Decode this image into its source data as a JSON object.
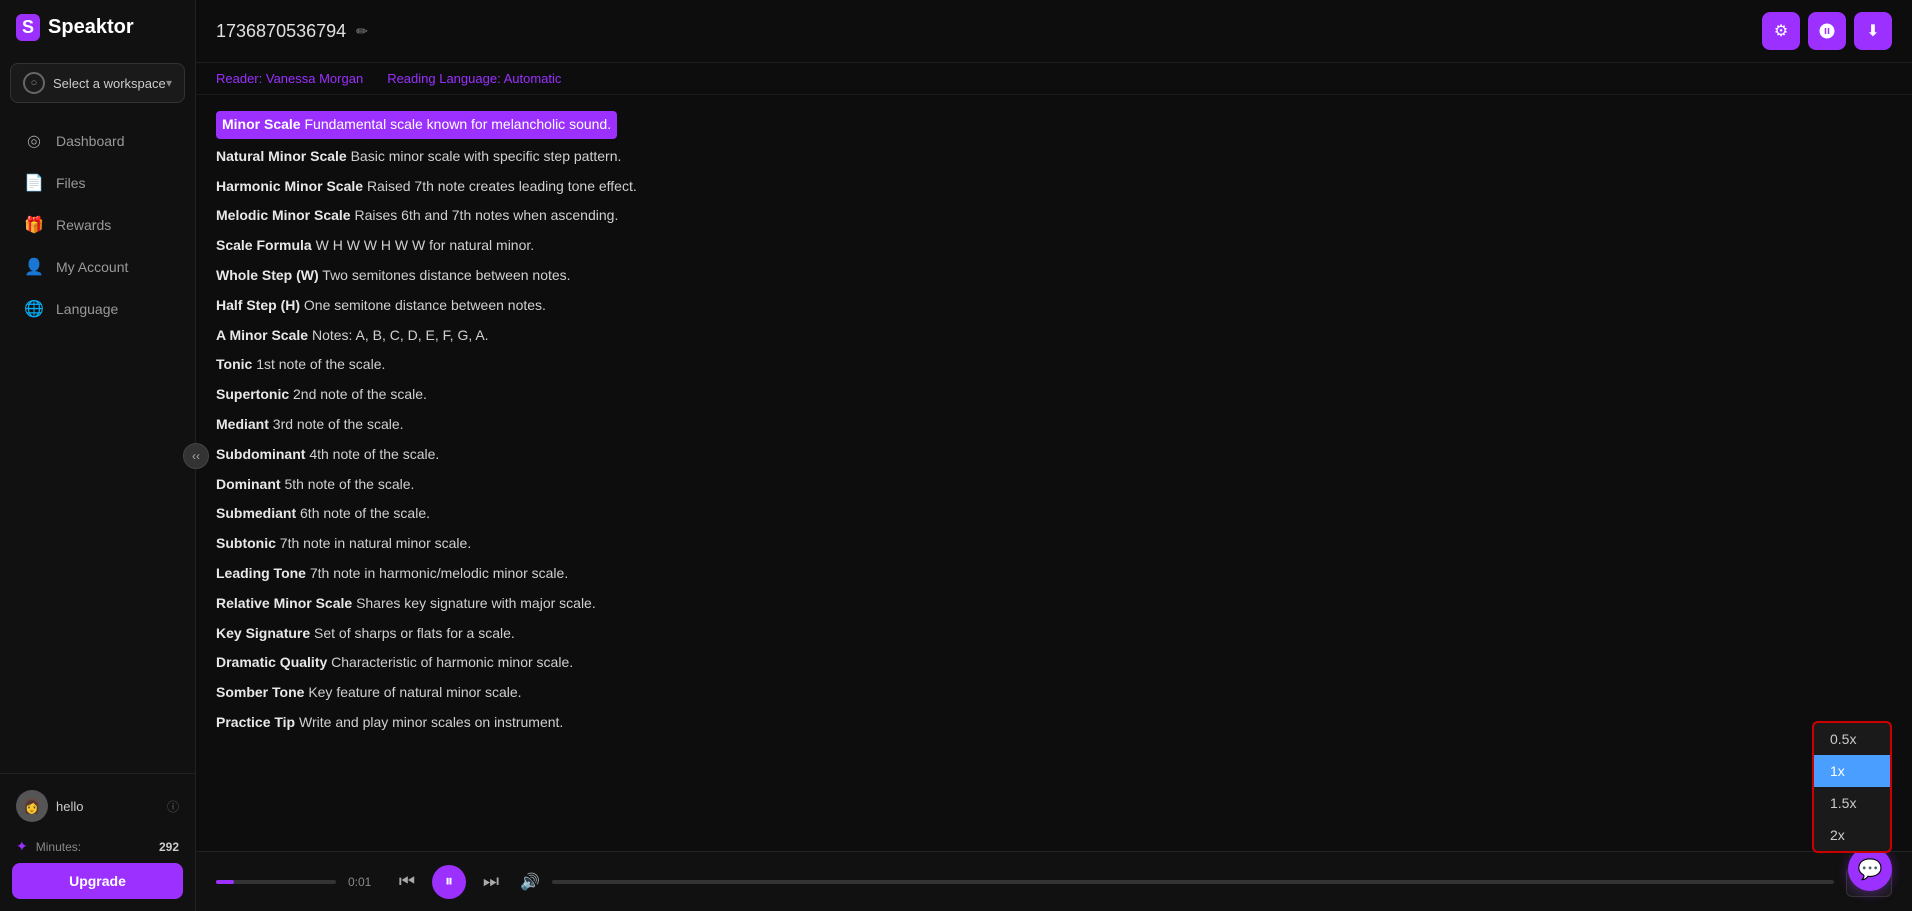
{
  "app": {
    "name": "Speaktor",
    "logo_letter": "S"
  },
  "workspace": {
    "placeholder": "Select a workspace"
  },
  "nav": {
    "items": [
      {
        "id": "dashboard",
        "label": "Dashboard",
        "icon": "⊙"
      },
      {
        "id": "files",
        "label": "Files",
        "icon": "📄"
      },
      {
        "id": "rewards",
        "label": "Rewards",
        "icon": "🎁"
      },
      {
        "id": "my-account",
        "label": "My Account",
        "icon": "👤"
      },
      {
        "id": "language",
        "label": "Language",
        "icon": "🌐"
      }
    ]
  },
  "user": {
    "name": "hello",
    "avatar_text": "👩"
  },
  "minutes": {
    "label": "Minutes:",
    "count": "292"
  },
  "upgrade": {
    "label": "Upgrade"
  },
  "header": {
    "doc_title": "1736870536794",
    "edit_tooltip": "Edit title"
  },
  "toolbar": {
    "settings_label": "⚙",
    "voice_label": "🔊",
    "download_label": "⬇"
  },
  "reader": {
    "reader_label": "Reader: Vanessa Morgan",
    "language_label": "Reading Language: Automatic"
  },
  "content": {
    "lines": [
      {
        "term": "Minor Scale",
        "desc": "Fundamental scale known for melancholic sound.",
        "highlighted": true
      },
      {
        "term": "Natural Minor Scale",
        "desc": "Basic minor scale with specific step pattern.",
        "highlighted": false
      },
      {
        "term": "Harmonic Minor Scale",
        "desc": "Raised 7th note creates leading tone effect.",
        "highlighted": false
      },
      {
        "term": "Melodic Minor Scale",
        "desc": "Raises 6th and 7th notes when ascending.",
        "highlighted": false
      },
      {
        "term": "Scale Formula",
        "desc": "W H W W H W W for natural minor.",
        "highlighted": false
      },
      {
        "term": "Whole Step (W)",
        "desc": "Two semitones distance between notes.",
        "highlighted": false
      },
      {
        "term": "Half Step (H)",
        "desc": "One semitone distance between notes.",
        "highlighted": false
      },
      {
        "term": "A Minor Scale",
        "desc": "Notes: A, B, C, D, E, F, G, A.",
        "highlighted": false
      },
      {
        "term": "Tonic",
        "desc": "1st note of the scale.",
        "highlighted": false
      },
      {
        "term": "Supertonic",
        "desc": "2nd note of the scale.",
        "highlighted": false
      },
      {
        "term": "Mediant",
        "desc": "3rd note of the scale.",
        "highlighted": false
      },
      {
        "term": "Subdominant",
        "desc": "4th note of the scale.",
        "highlighted": false
      },
      {
        "term": "Dominant",
        "desc": "5th note of the scale.",
        "highlighted": false
      },
      {
        "term": "Submediant",
        "desc": "6th note of the scale.",
        "highlighted": false
      },
      {
        "term": "Subtonic",
        "desc": "7th note in natural minor scale.",
        "highlighted": false
      },
      {
        "term": "Leading Tone",
        "desc": "7th note in harmonic/melodic minor scale.",
        "highlighted": false
      },
      {
        "term": "Relative Minor Scale",
        "desc": "Shares key signature with major scale.",
        "highlighted": false
      },
      {
        "term": "Key Signature",
        "desc": "Set of sharps or flats for a scale.",
        "highlighted": false
      },
      {
        "term": "Dramatic Quality",
        "desc": "Characteristic of harmonic minor scale.",
        "highlighted": false
      },
      {
        "term": "Somber Tone",
        "desc": "Key feature of natural minor scale.",
        "highlighted": false
      },
      {
        "term": "Practice Tip",
        "desc": "Write and play minor scales on instrument.",
        "highlighted": false
      }
    ]
  },
  "player": {
    "time": "0:01",
    "prev_icon": "⏮",
    "pause_icon": "⏸",
    "next_icon": "⏭",
    "volume_icon": "🔊",
    "progress_percent": 15
  },
  "speed_dropdown": {
    "options": [
      "0.5x",
      "1x",
      "1.5x",
      "2x"
    ],
    "selected": "1x",
    "current_label": "1x"
  },
  "chat": {
    "icon": "💬"
  }
}
